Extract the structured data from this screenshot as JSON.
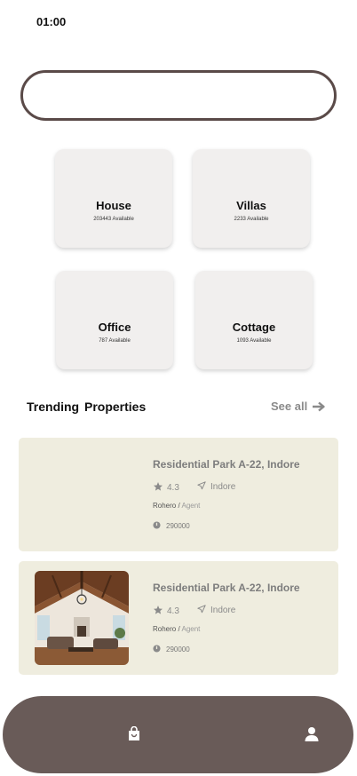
{
  "status_bar": {
    "time": "01:00"
  },
  "search": {
    "placeholder": ""
  },
  "categories": [
    {
      "name": "House",
      "available": "203443 Available"
    },
    {
      "name": "Villas",
      "available": "2233 Available"
    },
    {
      "name": "Office",
      "available": "787 Available"
    },
    {
      "name": "Cottage",
      "available": "1093 Available"
    }
  ],
  "trending": {
    "title": "Trending Properties",
    "see_all": "See all",
    "properties": [
      {
        "title": "Residential Park A-22, Indore",
        "rating": "4.3",
        "location": "Indore",
        "agent_name": "Rohero",
        "agent_sep": " / ",
        "agent_role": "Agent",
        "price": "290000",
        "has_image": false
      },
      {
        "title": "Residential Park A-22, Indore",
        "rating": "4.3",
        "location": "Indore",
        "agent_name": "Rohero",
        "agent_sep": " / ",
        "agent_role": "Agent",
        "price": "290000",
        "has_image": true
      }
    ]
  },
  "bottom_nav": {
    "items": [
      "bag-icon",
      "user-icon"
    ]
  },
  "colors": {
    "accent_dark": "#695b58",
    "card_bg": "#f1efee",
    "property_bg": "#efeddf",
    "muted_text": "#8a8a8a"
  }
}
